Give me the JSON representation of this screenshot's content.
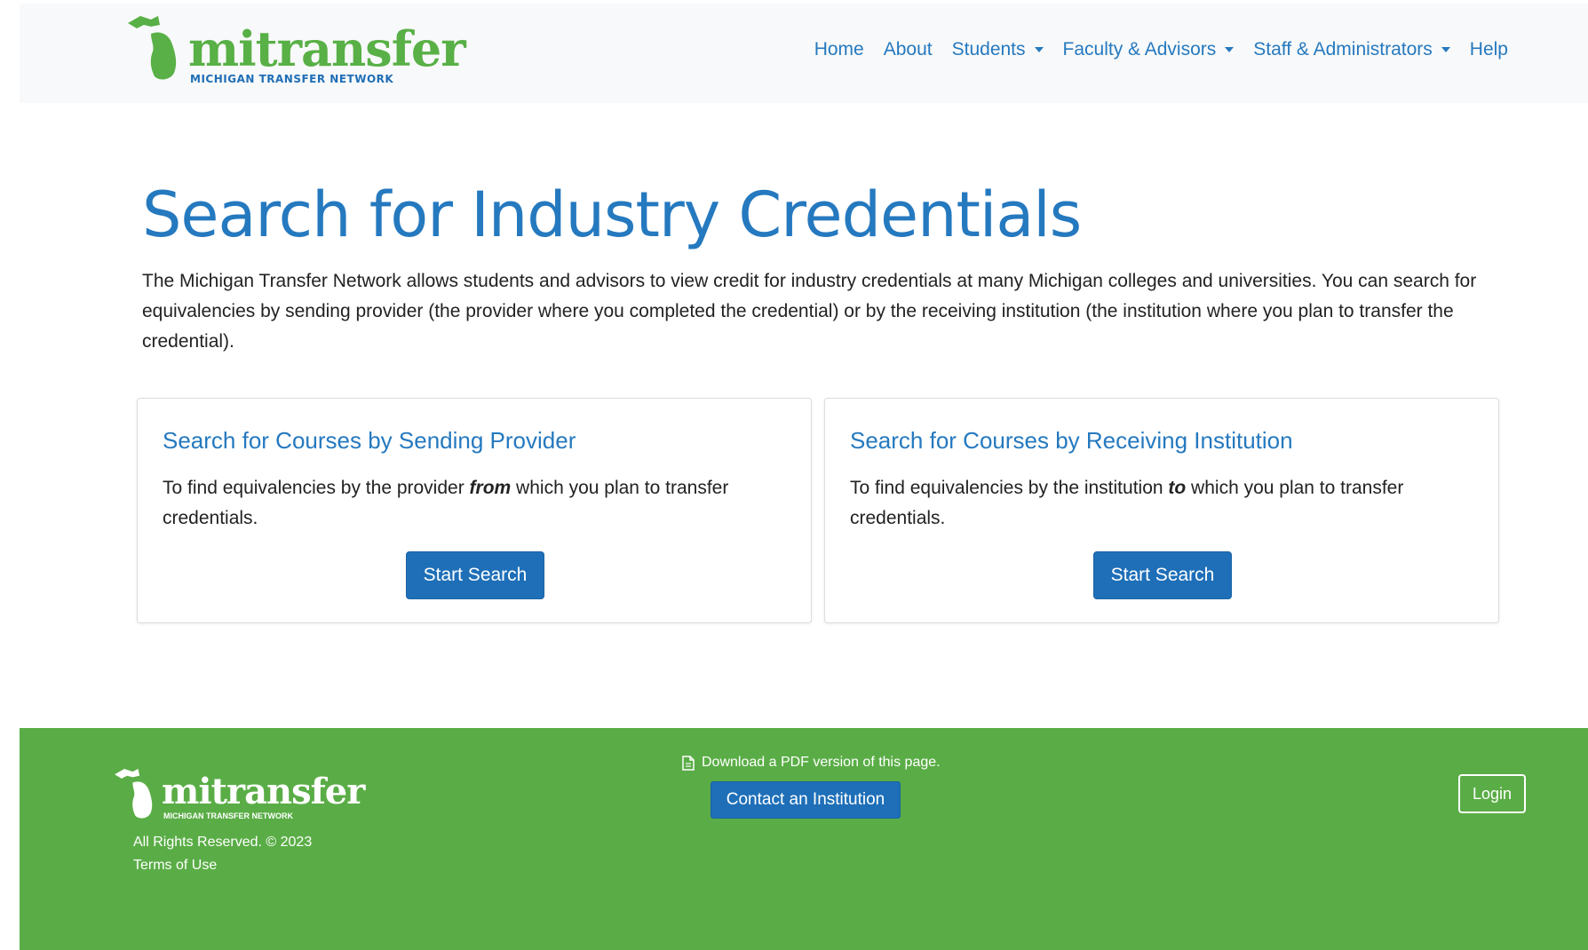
{
  "brand": {
    "logo_text": "mitransfer",
    "logo_subtitle": "MICHIGAN TRANSFER NETWORK",
    "colors": {
      "green": "#58b046",
      "blue": "#1f6eb6"
    }
  },
  "nav": {
    "items": [
      {
        "label": "Home",
        "dropdown": false
      },
      {
        "label": "About",
        "dropdown": false
      },
      {
        "label": "Students",
        "dropdown": true
      },
      {
        "label": "Faculty & Advisors",
        "dropdown": true
      },
      {
        "label": "Staff & Administrators",
        "dropdown": true
      },
      {
        "label": "Help",
        "dropdown": false
      }
    ]
  },
  "main": {
    "title": "Search for Industry Credentials",
    "intro": "The Michigan Transfer Network allows students and advisors to view credit for industry credentials at many Michigan colleges and universities.  You can search for equivalencies by sending provider (the provider where you completed the credential) or by the receiving institution (the institution where you plan to transfer the credential).",
    "cards": [
      {
        "title": "Search for Courses by Sending Provider",
        "text_before": "To find equivalencies by the provider ",
        "text_emphasis": "from",
        "text_after": " which you plan to transfer credentials.",
        "button": "Start Search"
      },
      {
        "title": "Search for Courses by Receiving Institution",
        "text_before": "To find equivalencies by the institution ",
        "text_emphasis": "to",
        "text_after": " which you plan to transfer credentials.",
        "button": "Start Search"
      }
    ]
  },
  "footer": {
    "logo_text": "mitransfer",
    "logo_subtitle": "MICHIGAN TRANSFER NETWORK",
    "copyright": "All Rights Reserved. © 2023",
    "terms": "Terms of Use",
    "pdf_link": "Download a PDF version of this page.",
    "pdf_icon": "file-icon",
    "contact_button": "Contact an Institution",
    "login_button": "Login",
    "background_color": "#5aad46"
  },
  "colors": {
    "link_blue": "#2579bf",
    "button_blue": "#1e6fb8"
  }
}
